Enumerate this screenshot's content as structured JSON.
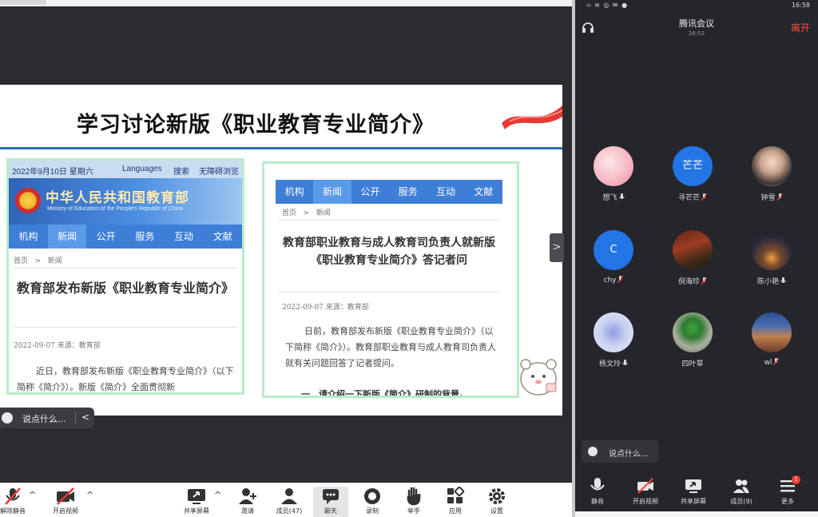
{
  "slide": {
    "title": "学习讨论新版《职业教育专业简介》",
    "card1": {
      "date": "2022年9月10日 星期六",
      "languages": "Languages",
      "search": "搜索",
      "accessibility": "无障碍浏览",
      "site_name": "中华人民共和国教育部",
      "site_name_en": "Ministry of Education of the People's Republic of China",
      "nav": [
        "机构",
        "新闻",
        "公开",
        "服务",
        "互动",
        "文献"
      ],
      "active_nav": "新闻",
      "breadcrumb_home": "首页",
      "breadcrumb_sep": ">",
      "breadcrumb_section": "新闻",
      "headline": "教育部发布新版《职业教育专业简介》",
      "meta": "2022-09-07    来源：教育部",
      "body": "近日，教育部发布新版《职业教育专业简介》（以下简称《简介》）。新版《简介》全面贯彻新"
    },
    "card2": {
      "nav": [
        "机构",
        "新闻",
        "公开",
        "服务",
        "互动",
        "文献"
      ],
      "active_nav": "新闻",
      "breadcrumb_home": "首页",
      "breadcrumb_sep": ">",
      "breadcrumb_section": "新闻",
      "headline": "教育部职业教育与成人教育司负责人就新版《职业教育专业简介》答记者问",
      "meta": "2022-09-07    来源：教育部",
      "body": "日前，教育部发布新版《职业教育专业简介》（以下简称《简介》）。教育部职业教育与成人教育司负责人就有关问题回答了记者提问。",
      "subhead": "一、请介绍一下新版《简介》研制的背景。"
    }
  },
  "desktop_chat": {
    "placeholder": "说点什么...",
    "collapse": "<"
  },
  "side_toggle": ">",
  "toolbar": {
    "items": [
      {
        "label": "解除静音",
        "icon": "mic-muted-icon"
      },
      {
        "label": "开启视频",
        "icon": "video-off-icon"
      },
      {
        "label": "共享屏幕",
        "icon": "share-screen-icon"
      },
      {
        "label": "邀请",
        "icon": "invite-icon"
      },
      {
        "label": "成员(47)",
        "icon": "members-icon"
      },
      {
        "label": "聊天",
        "icon": "chat-icon"
      },
      {
        "label": "录制",
        "icon": "record-icon"
      },
      {
        "label": "举手",
        "icon": "raise-hand-icon"
      },
      {
        "label": "应用",
        "icon": "apps-icon"
      },
      {
        "label": "设置",
        "icon": "settings-icon"
      }
    ],
    "caret": "^"
  },
  "phone": {
    "status_left": "፨ ≋ ◎ ✉ ●",
    "status_time": "16:58",
    "title": "腾讯会议",
    "duration": "26:52",
    "leave": "离开",
    "participants": [
      {
        "name": "想飞",
        "avatar_text": ""
      },
      {
        "name": "寻芒芒",
        "avatar_text": "芒芒"
      },
      {
        "name": "钟雪",
        "avatar_text": ""
      },
      {
        "name": "chy",
        "avatar_text": "C"
      },
      {
        "name": "倪海珍",
        "avatar_text": ""
      },
      {
        "name": "陈小艳",
        "avatar_text": ""
      },
      {
        "name": "杨文玲",
        "avatar_text": ""
      },
      {
        "name": "四叶草",
        "avatar_text": ""
      },
      {
        "name": "wl",
        "avatar_text": ""
      }
    ],
    "chat_placeholder": "说点什么...",
    "bottom": [
      {
        "label": "静音",
        "icon": "mic-icon"
      },
      {
        "label": "开启视频",
        "icon": "video-off-icon"
      },
      {
        "label": "共享屏幕",
        "icon": "share-screen-icon"
      },
      {
        "label": "成员(9)",
        "icon": "members-icon"
      },
      {
        "label": "更多",
        "icon": "more-icon"
      }
    ],
    "more_badge": "1"
  },
  "colors": {
    "accent_blue": "#2374e5",
    "leave_red": "#ff4b3a",
    "nav_blue": "#3e7ed7",
    "card_border": "#b9ecc9",
    "slide_rule": "#2e6cae"
  }
}
